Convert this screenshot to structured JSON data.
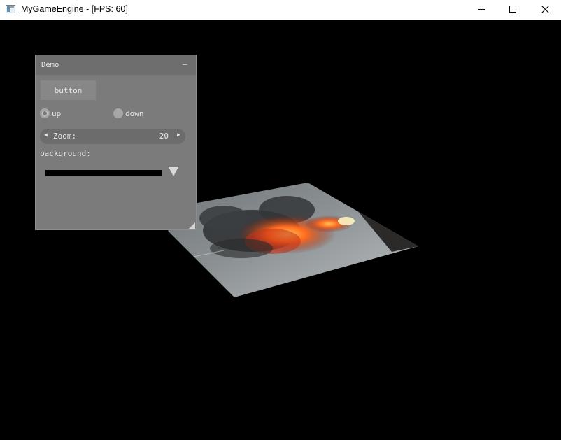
{
  "window": {
    "title": "MyGameEngine - [FPS: 60]",
    "icons": [
      "app-icon",
      "minimize-icon",
      "maximize-icon",
      "close-icon"
    ]
  },
  "panel": {
    "title": "Demo",
    "minimize_symbol": "–",
    "button_label": "button",
    "radios": [
      {
        "label": "up",
        "selected": true
      },
      {
        "label": "down",
        "selected": false
      }
    ],
    "property": {
      "label": "Zoom:",
      "value": "20",
      "left_arrow": "◀",
      "right_arrow": "▶"
    },
    "background_label": "background:",
    "background_color": "#000000"
  },
  "scene": {
    "background_color": "#000000",
    "textured_plane": "volcano-eruption-image"
  }
}
